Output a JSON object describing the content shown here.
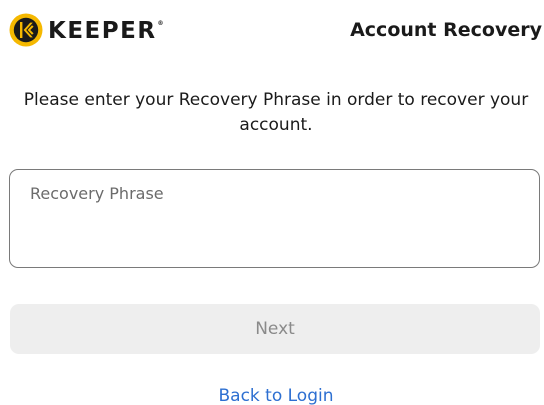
{
  "brand": {
    "name": "KEEPER",
    "trademark": "®",
    "logo_icon": "keeper-shield-icon",
    "logo_color": "#f5b800"
  },
  "header": {
    "title": "Account Recovery"
  },
  "main": {
    "instructions": "Please enter your Recovery Phrase in order to recover your account.",
    "recovery_phrase": {
      "value": "",
      "placeholder": "Recovery Phrase"
    },
    "next_label": "Next",
    "back_label": "Back to Login"
  },
  "colors": {
    "text": "#1a1a1a",
    "link": "#2d6fd1",
    "button_bg_disabled": "#eeeeee",
    "button_text_disabled": "#8a8a8a",
    "input_border": "#7a7a7a"
  }
}
